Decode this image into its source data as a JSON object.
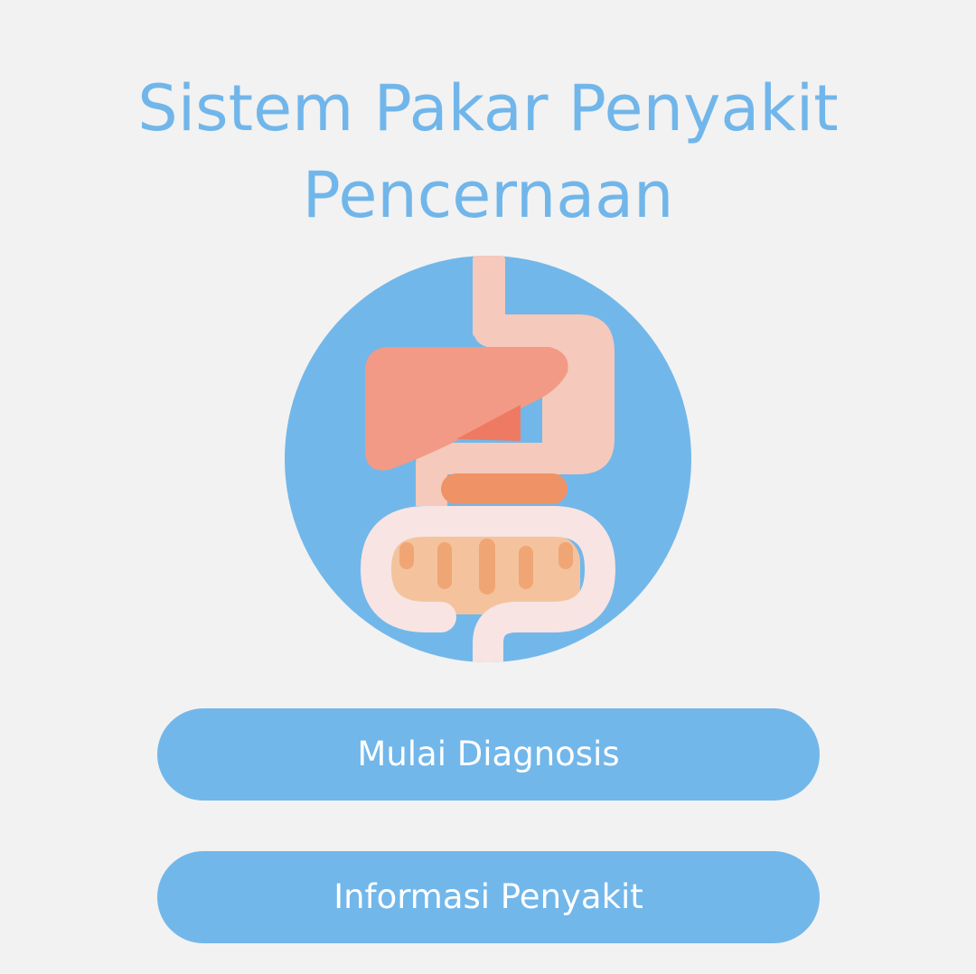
{
  "header": {
    "title_line1": "Sistem Pakar Penyakit",
    "title_line2": "Pencernaan"
  },
  "illustration": {
    "icon": "digestive-system-icon",
    "colors": {
      "circle": "#72b7ea",
      "esophagus_stomach": "#f5c9bb",
      "liver": "#f29a85",
      "gallbladder": "#ee7a63",
      "pancreas": "#ef9366",
      "small_intestine": "#f4c39d",
      "intestine_ridges": "#efa674",
      "large_intestine": "#f8e4e2"
    }
  },
  "buttons": {
    "diagnosis_label": "Mulai Diagnosis",
    "info_label": "Informasi Penyakit"
  },
  "theme": {
    "accent": "#72b7ea",
    "background": "#f2f2f2",
    "button_text": "#ffffff"
  }
}
